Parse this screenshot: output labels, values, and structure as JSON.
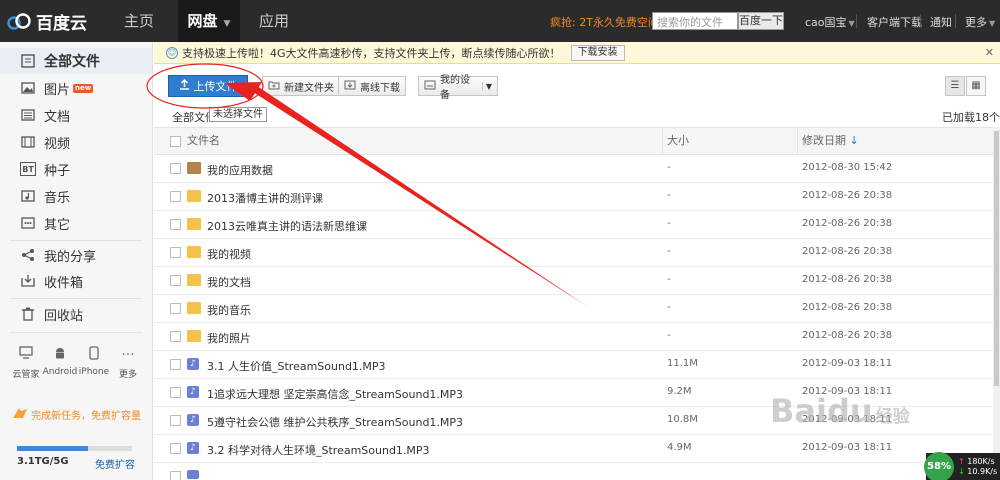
{
  "topbar": {
    "logo": "百度云",
    "tabs": [
      {
        "label": "主页"
      },
      {
        "label": "网盘"
      },
      {
        "label": "应用"
      }
    ],
    "promo": "疯抢: 2T永久免费空间",
    "search_placeholder": "搜索你的文件",
    "search_button": "百度一下",
    "user": "cao国宝",
    "client_download": "客户端下载",
    "notify": "通知",
    "more": "更多"
  },
  "sidebar": {
    "items": [
      {
        "label": "全部文件",
        "icon": "files-icon"
      },
      {
        "label": "图片",
        "icon": "image-icon",
        "badge": "new"
      },
      {
        "label": "文档",
        "icon": "document-icon"
      },
      {
        "label": "视频",
        "icon": "video-icon"
      },
      {
        "label": "种子",
        "icon": "bt-icon",
        "glyph": "BT"
      },
      {
        "label": "音乐",
        "icon": "music-icon"
      },
      {
        "label": "其它",
        "icon": "other-icon"
      },
      {
        "label": "我的分享",
        "icon": "share-icon"
      },
      {
        "label": "收件箱",
        "icon": "inbox-icon"
      },
      {
        "label": "回收站",
        "icon": "trash-icon"
      }
    ],
    "devices": [
      {
        "label": "云管家",
        "icon": "monitor-icon"
      },
      {
        "label": "Android",
        "icon": "android-icon"
      },
      {
        "label": "iPhone",
        "icon": "iphone-icon"
      },
      {
        "label": "更多",
        "icon": "more-dots-icon"
      }
    ],
    "task": "完成新任务，免费扩容量",
    "quota_text": "3.1TG/5G",
    "quota_fraction": 0.62,
    "quota_link": "免费扩容"
  },
  "banner": {
    "text": "支持极速上传啦！4G大文件高速秒传，支持文件夹上传，断点续传随心所欲！",
    "button": "下载安装"
  },
  "toolbar": {
    "upload": "上传文件",
    "new_folder": "新建文件夹",
    "offline": "离线下载",
    "devices": "我的设备"
  },
  "breadcrumb": "全部文件",
  "tooltip": "未选择文件",
  "loaded_count": "已加载18个",
  "table": {
    "headers": {
      "name": "文件名",
      "size": "大小",
      "date": "修改日期"
    },
    "rows": [
      {
        "name": "我的应用数据",
        "size": "-",
        "date": "2012-08-30 15:42",
        "type": "app"
      },
      {
        "name": "2013潘博主讲的测评课",
        "size": "-",
        "date": "2012-08-26 20:38",
        "type": "folder"
      },
      {
        "name": "2013云唯真主讲的语法新思维课",
        "size": "-",
        "date": "2012-08-26 20:38",
        "type": "folder"
      },
      {
        "name": "我的视频",
        "size": "-",
        "date": "2012-08-26 20:38",
        "type": "folder"
      },
      {
        "name": "我的文档",
        "size": "-",
        "date": "2012-08-26 20:38",
        "type": "folder"
      },
      {
        "name": "我的音乐",
        "size": "-",
        "date": "2012-08-26 20:38",
        "type": "folder"
      },
      {
        "name": "我的照片",
        "size": "-",
        "date": "2012-08-26 20:38",
        "type": "folder"
      },
      {
        "name": "3.1 人生价值_StreamSound1.MP3",
        "size": "11.1M",
        "date": "2012-09-03 18:11",
        "type": "audio"
      },
      {
        "name": "1追求远大理想 坚定崇高信念_StreamSound1.MP3",
        "size": "9.2M",
        "date": "2012-09-03 18:11",
        "type": "audio"
      },
      {
        "name": "5遵守社会公德 维护公共秩序_StreamSound1.MP3",
        "size": "10.8M",
        "date": "2012-09-03 18:11",
        "type": "audio"
      },
      {
        "name": "3.2 科学对待人生环境_StreamSound1.MP3",
        "size": "4.9M",
        "date": "2012-09-03 18:11",
        "type": "audio"
      }
    ]
  },
  "watermark": {
    "text": "Baidu",
    "sub": "经验"
  },
  "speed": {
    "percent": "58%",
    "up": "180K/s",
    "down": "10.9K/s"
  },
  "colors": {
    "accent": "#2f7cd3",
    "annotation": "#e8231f",
    "topbar": "#2b2b2b"
  }
}
